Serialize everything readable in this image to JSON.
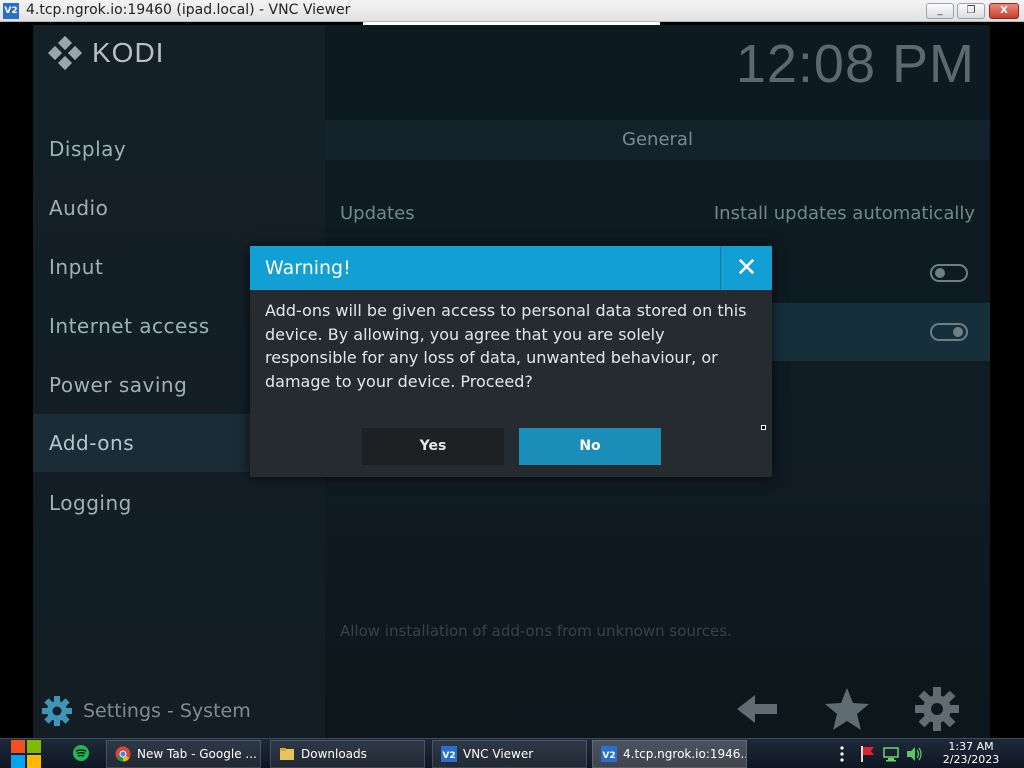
{
  "window": {
    "title": "4.tcp.ngrok.io:19460 (ipad.local) - VNC Viewer",
    "icon_label": "V2",
    "min_label": "_",
    "max_label": "❐",
    "close_label": "X"
  },
  "kodi": {
    "logo_text": "KODI",
    "clock": "12:08 PM",
    "menu": [
      "Display",
      "Audio",
      "Input",
      "Internet access",
      "Power saving",
      "Add-ons",
      "Logging"
    ],
    "active_menu_index": 5,
    "panel": {
      "heading": "General",
      "updates_label": "Updates",
      "updates_value": "Install updates automatically",
      "hint": "Allow installation of add-ons from unknown sources."
    },
    "footer_title": "Settings - System"
  },
  "dialog": {
    "title": "Warning!",
    "close_label": "✕",
    "message": "Add-ons will be given access to personal data stored on this device. By allowing, you agree that you are solely responsible for any loss of data, unwanted behaviour, or damage to your device. Proceed?",
    "yes_label": "Yes",
    "no_label": "No"
  },
  "taskbar": {
    "items": [
      {
        "label": "New Tab - Google ...",
        "icon": "chrome-icon"
      },
      {
        "label": "Downloads",
        "icon": "folder-icon"
      },
      {
        "label": "VNC Viewer",
        "icon": "vnc-icon"
      },
      {
        "label": "4.tcp.ngrok.io:1946...",
        "icon": "vnc-icon"
      }
    ],
    "time": "1:37 AM",
    "date": "2/23/2023"
  },
  "colors": {
    "accent": "#12a0d4",
    "no_button": "#1a8db8"
  }
}
